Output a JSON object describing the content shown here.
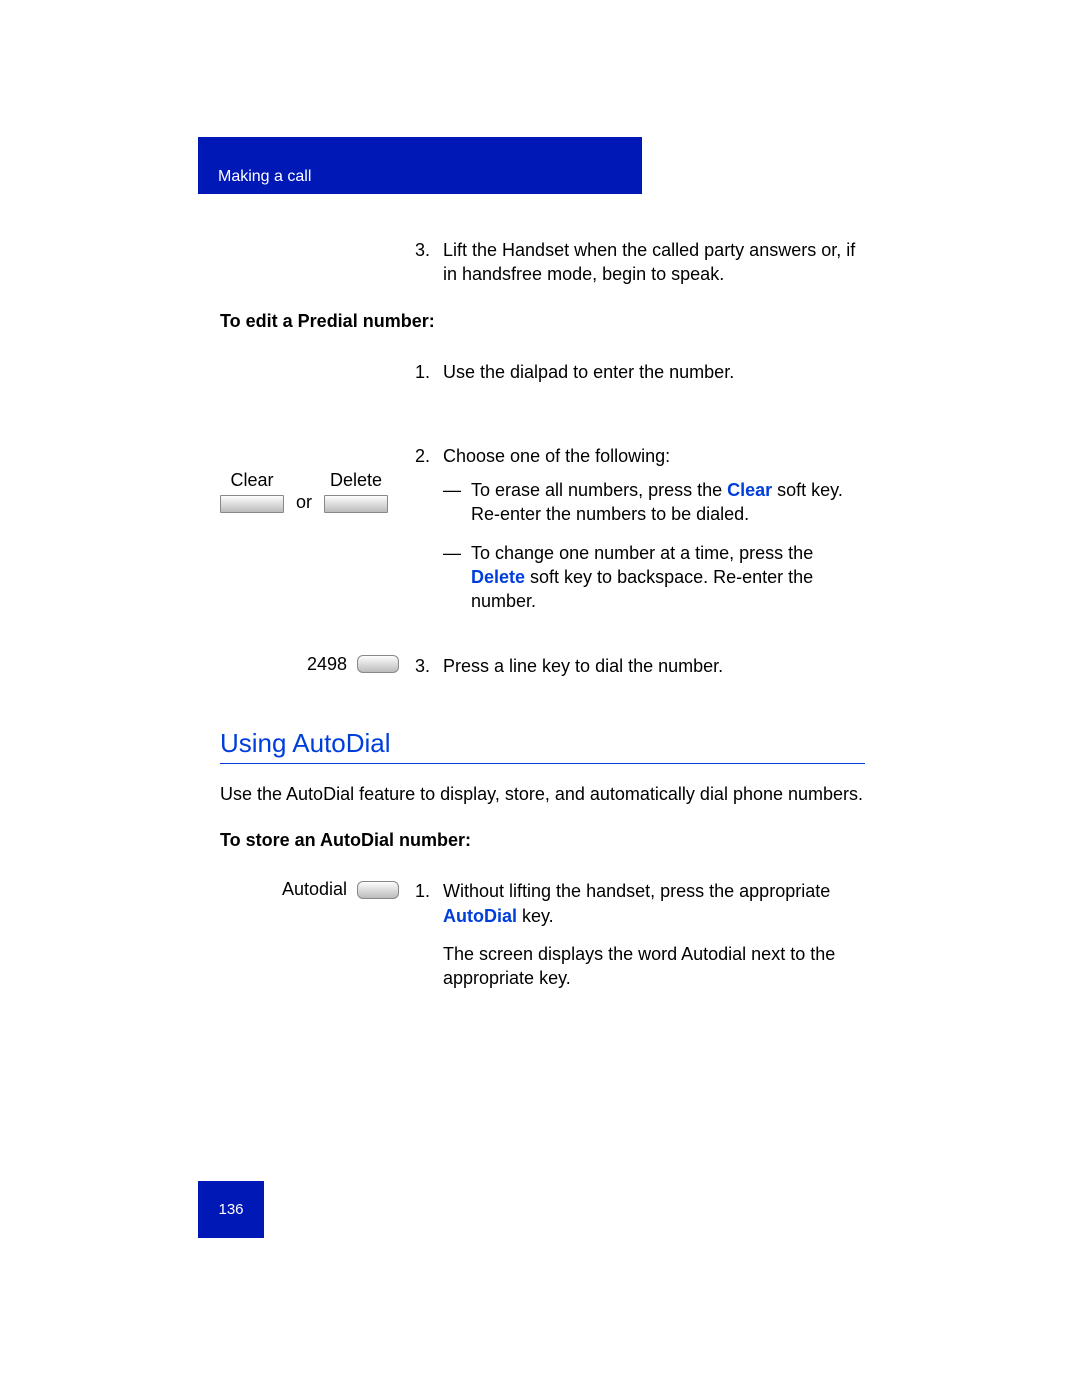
{
  "header": {
    "section": "Making a call"
  },
  "step3": {
    "num": "3.",
    "text": "Lift the Handset when the called party answers or, if in handsfree mode, begin to speak."
  },
  "predial": {
    "heading": "To edit a Predial number:",
    "step1": {
      "num": "1.",
      "text": "Use the dialpad to enter the number."
    },
    "softkeys": {
      "clear": "Clear",
      "or": "or",
      "delete": "Delete"
    },
    "step2": {
      "num": "2.",
      "intro": "Choose one of the following:",
      "b1_dash": "—",
      "b1_pre": "To erase all numbers, press the ",
      "b1_key": "Clear",
      "b1_post": " soft key. Re-enter the numbers to be dialed.",
      "b2_dash": "—",
      "b2_pre": "To change one number at a time, press the ",
      "b2_key": "Delete",
      "b2_post": " soft key to backspace. Re-enter the number."
    },
    "linekey": {
      "label": "2498"
    },
    "step3b": {
      "num": "3.",
      "text": "Press a line key to dial the number."
    }
  },
  "autodial": {
    "title": "Using AutoDial",
    "intro": "Use the AutoDial feature to display, store, and automatically dial phone numbers.",
    "heading": "To store an AutoDial number:",
    "key_label": "Autodial",
    "step1": {
      "num": "1.",
      "pre": "Without lifting the handset, press the appropriate ",
      "key": "AutoDial",
      "post": " key.",
      "para2": "The screen displays the word Autodial next to the appropriate key."
    }
  },
  "footer": {
    "page": "136"
  }
}
